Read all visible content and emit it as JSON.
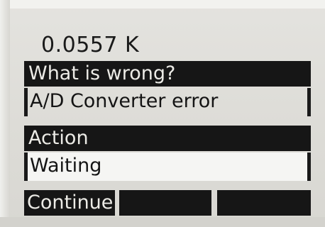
{
  "display": {
    "reading": "0.0557 K"
  },
  "diagnostic": {
    "question_label": "What is wrong?",
    "question_value": "A/D Converter error",
    "action_label": "Action",
    "action_value": "Waiting"
  },
  "softkeys": {
    "key1": "Continue",
    "key2": "",
    "key3": ""
  }
}
